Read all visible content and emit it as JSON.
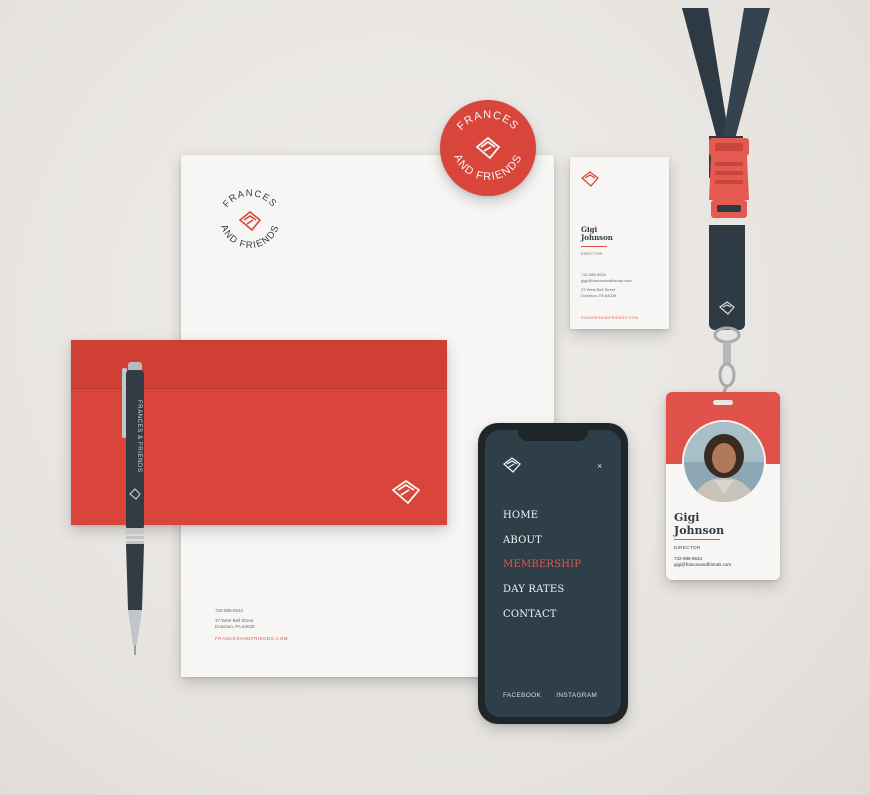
{
  "brand": {
    "name_top": "FRANCES",
    "name_bottom": "AND FRIENDS",
    "pen_text": "FRANCES & FRIENDS",
    "accent": "#d9453a",
    "dark": "#2f3d47"
  },
  "letterhead": {
    "phone": "732-985-5534",
    "address_line1": "37 West Bell Street",
    "address_line2": "Downton, PA 64028",
    "website": "FRANCESANDFRIENDS.COM"
  },
  "business_card": {
    "first_name": "Gigi",
    "last_name": "Johnson",
    "title": "DIRECTOR",
    "phone": "732-985-5534",
    "email": "gigi@francesandfriends.com",
    "address_line1": "37 West Bell Street",
    "address_line2": "Downton, PA 64028",
    "website": "FRANCESANDFRIENDS.COM"
  },
  "id_badge": {
    "first_name": "Gigi",
    "last_name": "Johnson",
    "title": "DIRECTOR",
    "phone": "732-985-5534",
    "email": "gigi@francesandfriends.com"
  },
  "phone_screen": {
    "close_glyph": "×",
    "menu": [
      "HOME",
      "ABOUT",
      "MEMBERSHIP",
      "DAY RATES",
      "CONTACT"
    ],
    "active_item": "MEMBERSHIP",
    "social": [
      "FACEBOOK",
      "INSTAGRAM"
    ]
  }
}
